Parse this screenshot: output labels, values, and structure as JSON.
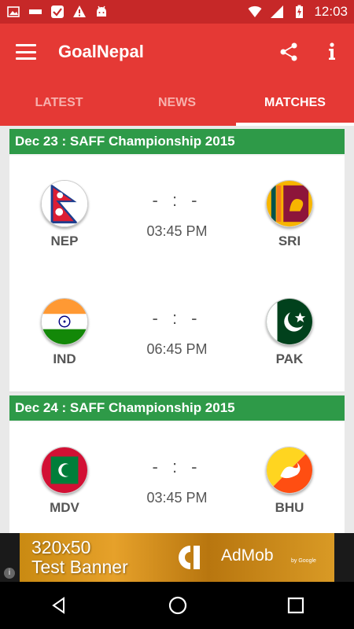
{
  "status_bar": {
    "time": "12:03",
    "icons": [
      "image-icon",
      "notification-logo-icon",
      "check-icon",
      "warning-icon",
      "android-icon",
      "wifi-icon",
      "signal-icon",
      "battery-charging-icon"
    ]
  },
  "app_bar": {
    "title": "GoalNepal",
    "menu_icon": "hamburger-menu-icon",
    "share_icon": "share-icon",
    "info_icon": "info-icon"
  },
  "tabs": [
    {
      "label": "LATEST",
      "active": false
    },
    {
      "label": "NEWS",
      "active": false
    },
    {
      "label": "MATCHES",
      "active": true
    }
  ],
  "colors": {
    "status_bar": "#c62828",
    "app_bar": "#e53935",
    "day_header": "#2e9a48",
    "inactive_tab": "#f7b1ad"
  },
  "days": [
    {
      "header": "Dec 23 : SAFF Championship 2015",
      "matches": [
        {
          "home": "NEP",
          "away": "SRI",
          "score": "- : -",
          "time": "03:45 PM"
        },
        {
          "home": "IND",
          "away": "PAK",
          "score": "- : -",
          "time": "06:45 PM"
        }
      ]
    },
    {
      "header": "Dec 24 : SAFF Championship 2015",
      "matches": [
        {
          "home": "MDV",
          "away": "BHU",
          "score": "- : -",
          "time": "03:45 PM"
        }
      ]
    }
  ],
  "ad": {
    "text_line1": "320x50",
    "text_line2": "Test Banner",
    "brand": "AdMob",
    "sub": "by Google",
    "info": "i"
  },
  "nav_bar": {
    "icons": [
      "back-icon",
      "home-icon",
      "recents-icon"
    ]
  }
}
